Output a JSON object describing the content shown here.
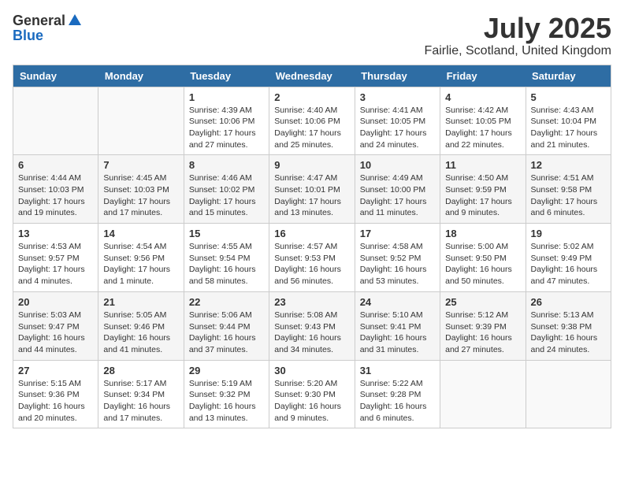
{
  "header": {
    "logo_general": "General",
    "logo_blue": "Blue",
    "month_title": "July 2025",
    "location": "Fairlie, Scotland, United Kingdom"
  },
  "days_of_week": [
    "Sunday",
    "Monday",
    "Tuesday",
    "Wednesday",
    "Thursday",
    "Friday",
    "Saturday"
  ],
  "weeks": [
    [
      {
        "day": "",
        "info": ""
      },
      {
        "day": "",
        "info": ""
      },
      {
        "day": "1",
        "sunrise": "Sunrise: 4:39 AM",
        "sunset": "Sunset: 10:06 PM",
        "daylight": "Daylight: 17 hours and 27 minutes."
      },
      {
        "day": "2",
        "sunrise": "Sunrise: 4:40 AM",
        "sunset": "Sunset: 10:06 PM",
        "daylight": "Daylight: 17 hours and 25 minutes."
      },
      {
        "day": "3",
        "sunrise": "Sunrise: 4:41 AM",
        "sunset": "Sunset: 10:05 PM",
        "daylight": "Daylight: 17 hours and 24 minutes."
      },
      {
        "day": "4",
        "sunrise": "Sunrise: 4:42 AM",
        "sunset": "Sunset: 10:05 PM",
        "daylight": "Daylight: 17 hours and 22 minutes."
      },
      {
        "day": "5",
        "sunrise": "Sunrise: 4:43 AM",
        "sunset": "Sunset: 10:04 PM",
        "daylight": "Daylight: 17 hours and 21 minutes."
      }
    ],
    [
      {
        "day": "6",
        "sunrise": "Sunrise: 4:44 AM",
        "sunset": "Sunset: 10:03 PM",
        "daylight": "Daylight: 17 hours and 19 minutes."
      },
      {
        "day": "7",
        "sunrise": "Sunrise: 4:45 AM",
        "sunset": "Sunset: 10:03 PM",
        "daylight": "Daylight: 17 hours and 17 minutes."
      },
      {
        "day": "8",
        "sunrise": "Sunrise: 4:46 AM",
        "sunset": "Sunset: 10:02 PM",
        "daylight": "Daylight: 17 hours and 15 minutes."
      },
      {
        "day": "9",
        "sunrise": "Sunrise: 4:47 AM",
        "sunset": "Sunset: 10:01 PM",
        "daylight": "Daylight: 17 hours and 13 minutes."
      },
      {
        "day": "10",
        "sunrise": "Sunrise: 4:49 AM",
        "sunset": "Sunset: 10:00 PM",
        "daylight": "Daylight: 17 hours and 11 minutes."
      },
      {
        "day": "11",
        "sunrise": "Sunrise: 4:50 AM",
        "sunset": "Sunset: 9:59 PM",
        "daylight": "Daylight: 17 hours and 9 minutes."
      },
      {
        "day": "12",
        "sunrise": "Sunrise: 4:51 AM",
        "sunset": "Sunset: 9:58 PM",
        "daylight": "Daylight: 17 hours and 6 minutes."
      }
    ],
    [
      {
        "day": "13",
        "sunrise": "Sunrise: 4:53 AM",
        "sunset": "Sunset: 9:57 PM",
        "daylight": "Daylight: 17 hours and 4 minutes."
      },
      {
        "day": "14",
        "sunrise": "Sunrise: 4:54 AM",
        "sunset": "Sunset: 9:56 PM",
        "daylight": "Daylight: 17 hours and 1 minute."
      },
      {
        "day": "15",
        "sunrise": "Sunrise: 4:55 AM",
        "sunset": "Sunset: 9:54 PM",
        "daylight": "Daylight: 16 hours and 58 minutes."
      },
      {
        "day": "16",
        "sunrise": "Sunrise: 4:57 AM",
        "sunset": "Sunset: 9:53 PM",
        "daylight": "Daylight: 16 hours and 56 minutes."
      },
      {
        "day": "17",
        "sunrise": "Sunrise: 4:58 AM",
        "sunset": "Sunset: 9:52 PM",
        "daylight": "Daylight: 16 hours and 53 minutes."
      },
      {
        "day": "18",
        "sunrise": "Sunrise: 5:00 AM",
        "sunset": "Sunset: 9:50 PM",
        "daylight": "Daylight: 16 hours and 50 minutes."
      },
      {
        "day": "19",
        "sunrise": "Sunrise: 5:02 AM",
        "sunset": "Sunset: 9:49 PM",
        "daylight": "Daylight: 16 hours and 47 minutes."
      }
    ],
    [
      {
        "day": "20",
        "sunrise": "Sunrise: 5:03 AM",
        "sunset": "Sunset: 9:47 PM",
        "daylight": "Daylight: 16 hours and 44 minutes."
      },
      {
        "day": "21",
        "sunrise": "Sunrise: 5:05 AM",
        "sunset": "Sunset: 9:46 PM",
        "daylight": "Daylight: 16 hours and 41 minutes."
      },
      {
        "day": "22",
        "sunrise": "Sunrise: 5:06 AM",
        "sunset": "Sunset: 9:44 PM",
        "daylight": "Daylight: 16 hours and 37 minutes."
      },
      {
        "day": "23",
        "sunrise": "Sunrise: 5:08 AM",
        "sunset": "Sunset: 9:43 PM",
        "daylight": "Daylight: 16 hours and 34 minutes."
      },
      {
        "day": "24",
        "sunrise": "Sunrise: 5:10 AM",
        "sunset": "Sunset: 9:41 PM",
        "daylight": "Daylight: 16 hours and 31 minutes."
      },
      {
        "day": "25",
        "sunrise": "Sunrise: 5:12 AM",
        "sunset": "Sunset: 9:39 PM",
        "daylight": "Daylight: 16 hours and 27 minutes."
      },
      {
        "day": "26",
        "sunrise": "Sunrise: 5:13 AM",
        "sunset": "Sunset: 9:38 PM",
        "daylight": "Daylight: 16 hours and 24 minutes."
      }
    ],
    [
      {
        "day": "27",
        "sunrise": "Sunrise: 5:15 AM",
        "sunset": "Sunset: 9:36 PM",
        "daylight": "Daylight: 16 hours and 20 minutes."
      },
      {
        "day": "28",
        "sunrise": "Sunrise: 5:17 AM",
        "sunset": "Sunset: 9:34 PM",
        "daylight": "Daylight: 16 hours and 17 minutes."
      },
      {
        "day": "29",
        "sunrise": "Sunrise: 5:19 AM",
        "sunset": "Sunset: 9:32 PM",
        "daylight": "Daylight: 16 hours and 13 minutes."
      },
      {
        "day": "30",
        "sunrise": "Sunrise: 5:20 AM",
        "sunset": "Sunset: 9:30 PM",
        "daylight": "Daylight: 16 hours and 9 minutes."
      },
      {
        "day": "31",
        "sunrise": "Sunrise: 5:22 AM",
        "sunset": "Sunset: 9:28 PM",
        "daylight": "Daylight: 16 hours and 6 minutes."
      },
      {
        "day": "",
        "info": ""
      },
      {
        "day": "",
        "info": ""
      }
    ]
  ]
}
